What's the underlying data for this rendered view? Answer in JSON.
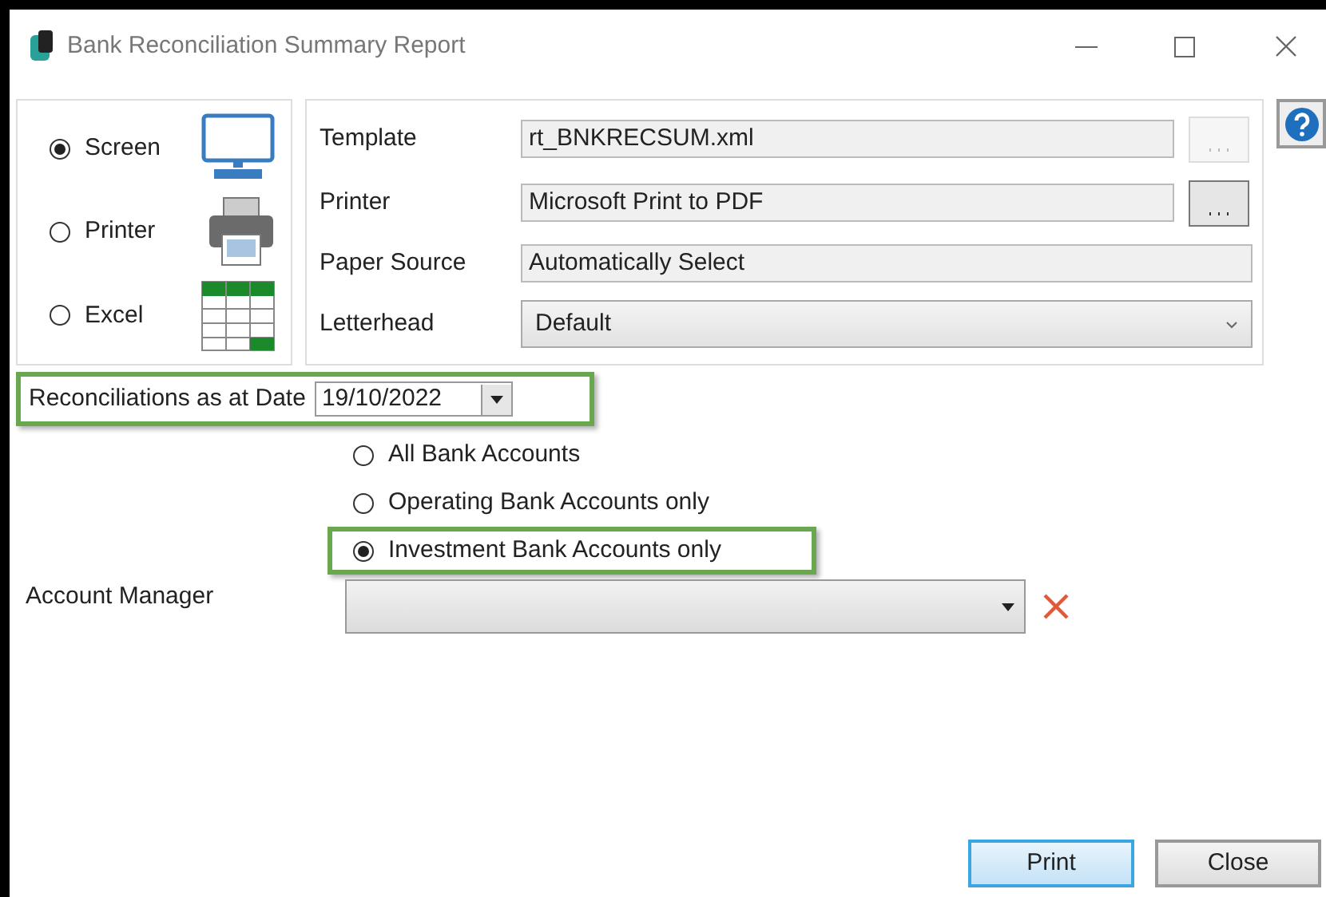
{
  "window": {
    "title": "Bank Reconciliation Summary Report"
  },
  "output_options": [
    {
      "kind": "screen",
      "label": "Screen",
      "selected": true
    },
    {
      "kind": "printer",
      "label": "Printer",
      "selected": false
    },
    {
      "kind": "excel",
      "label": "Excel",
      "selected": false
    }
  ],
  "settings": [
    {
      "label": "Template",
      "value": "rt_BNKRECSUM.xml",
      "kind": "browse",
      "disabled": true
    },
    {
      "label": "Printer",
      "value": "Microsoft Print to PDF",
      "kind": "browse",
      "disabled": false
    },
    {
      "label": "Paper Source",
      "value": "Automatically Select",
      "kind": "text"
    },
    {
      "label": "Letterhead",
      "value": "Default",
      "kind": "dropdown"
    }
  ],
  "date_field": {
    "label": "Reconciliations as at Date",
    "value": "19/10/2022",
    "highlighted": true
  },
  "account_types": [
    {
      "label": "All Bank Accounts",
      "selected": false,
      "highlighted": false
    },
    {
      "label": "Operating Bank Accounts only",
      "selected": false,
      "highlighted": false
    },
    {
      "label": "Investment Bank Accounts only",
      "selected": true,
      "highlighted": true
    }
  ],
  "account_manager": {
    "label": "Account Manager"
  },
  "buttons": [
    {
      "label": "Print",
      "default": true
    },
    {
      "label": "Close",
      "default": false
    }
  ]
}
